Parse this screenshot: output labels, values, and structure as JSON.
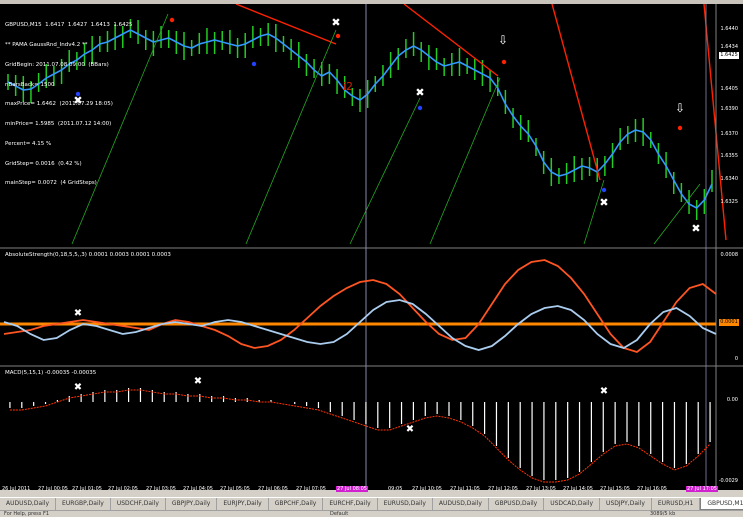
{
  "window": {
    "symbol_line": "GBPUSD,M15  1.6417  1.6427  1.6413  1.6425"
  },
  "info_lines": [
    "** PAMA GaussRnd_Indv4.2 **",
    "GridBegin: 2011.07.08 09:00  (BBars)",
    "nBarsBack= 1500",
    "maxPrice= 1.6462  (2011.07.29 18:05)",
    "minPrice= 1.5985  (2011.07.12 14:00)",
    "Percent= 4.15 %",
    "GridStep= 0.0016  (0.42 %)",
    "mainStep= 0.0072  (4 GridSteps)"
  ],
  "price_axis": [
    "1.6440",
    "1.6434",
    "1.6425",
    "1.6405",
    "1.6390",
    "1.6370",
    "1.6355",
    "1.6340",
    "1.6325"
  ],
  "current_price": "1.6425",
  "annotations": [
    "i2"
  ],
  "panes": {
    "absolute_strength": {
      "label": "AbsoluteStrength(0,18,5,5,,3) 0.0001 0.0003 0.0001 0.0003",
      "axis_top": "0.0008",
      "axis_level": "0.0001",
      "axis_bottom": "0"
    },
    "macd": {
      "label": "MACD(5,15,1) -0.00035 -0.00035",
      "axis_top": "0.00",
      "axis_bottom": "-0.0029"
    }
  },
  "time_axis": [
    {
      "label": "26 Jul 2011",
      "highlight": false
    },
    {
      "label": "27 Jul 00:05",
      "highlight": false
    },
    {
      "label": "27 Jul 01:05",
      "highlight": false
    },
    {
      "label": "27 Jul 02:05",
      "highlight": false
    },
    {
      "label": "27 Jul 03:05",
      "highlight": false
    },
    {
      "label": "27 Jul 04:05",
      "highlight": false
    },
    {
      "label": "27 Jul 05:05",
      "highlight": false
    },
    {
      "label": "27 Jul 06:05",
      "highlight": false
    },
    {
      "label": "27 Jul 07:05",
      "highlight": false
    },
    {
      "label": "27 Jul 08:05",
      "highlight": true
    },
    {
      "label": "09:05",
      "highlight": false
    },
    {
      "label": "27 Jul 10:05",
      "highlight": false
    },
    {
      "label": "27 Jul 11:05",
      "highlight": false
    },
    {
      "label": "27 Jul 12:05",
      "highlight": false
    },
    {
      "label": "27 Jul 13:05",
      "highlight": false
    },
    {
      "label": "27 Jul 14:05",
      "highlight": false
    },
    {
      "label": "27 Jul 15:05",
      "highlight": false
    },
    {
      "label": "27 Jul 16:05",
      "highlight": false
    },
    {
      "label": "27 Jul 17:05",
      "highlight": true
    }
  ],
  "tabs": [
    {
      "label": "AUDUSD,Daily",
      "active": false
    },
    {
      "label": "EURGBP,Daily",
      "active": false
    },
    {
      "label": "USDCHF,Daily",
      "active": false
    },
    {
      "label": "GBPJPY,Daily",
      "active": false
    },
    {
      "label": "EURJPY,Daily",
      "active": false
    },
    {
      "label": "GBPCHF,Daily",
      "active": false
    },
    {
      "label": "EURCHF,Daily",
      "active": false
    },
    {
      "label": "EURUSD,Daily",
      "active": false
    },
    {
      "label": "AUDUSD,Daily",
      "active": false
    },
    {
      "label": "GBPUSD,Daily",
      "active": false
    },
    {
      "label": "USDCAD,Daily",
      "active": false
    },
    {
      "label": "USDJPY,Daily",
      "active": false
    },
    {
      "label": "EURUSD,H1",
      "active": false
    },
    {
      "label": "GBPUSD,M15",
      "active": true
    }
  ],
  "status": {
    "left": "For Help, press F1",
    "middle": "Default",
    "right": "3089/5 kb"
  },
  "colors": {
    "background": "#000000",
    "candle_up": "#22cc22",
    "ma_line": "#3399ff",
    "level_line": "#ff8800",
    "as_line_bull": "#ff5522",
    "as_line_bear": "#aaccee",
    "macd_signal": "#ff3300",
    "macd_hist": "#ffffff",
    "trend_red": "#ff2200",
    "trend_green": "#22aa22",
    "highlight_time": "#d020d0"
  }
}
